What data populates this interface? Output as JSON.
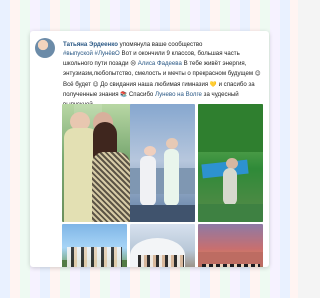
{
  "post": {
    "author": "Татьяна Эрдеенко",
    "headline": "упомянула ваше сообщество",
    "hashtag": "#выпуской #ЛунёвО",
    "body_1": "Вот и окончили 9 классов, большая часть школьного пути позади",
    "emoji_1": "😢",
    "mention_1": "Алиса Фадеева",
    "body_2": "В тебе живёт энергия, энтузиазм,любопытство, смелость и мечты о прекрасном будущем",
    "emoji_2": "😊",
    "body_3": "Всё будет",
    "emoji_3": "😉",
    "body_4": "До свидания наша любимая гимназия",
    "emoji_4": "💛",
    "body_5": "и спасибо за полученные знания",
    "emoji_5": "📚",
    "body_6": "Спасибо",
    "mention_2": "Лунево на Волге",
    "body_7": "за чудесный выпускной"
  },
  "colors": {
    "link": "#2a5885",
    "text": "#222222",
    "card": "#ffffff"
  }
}
